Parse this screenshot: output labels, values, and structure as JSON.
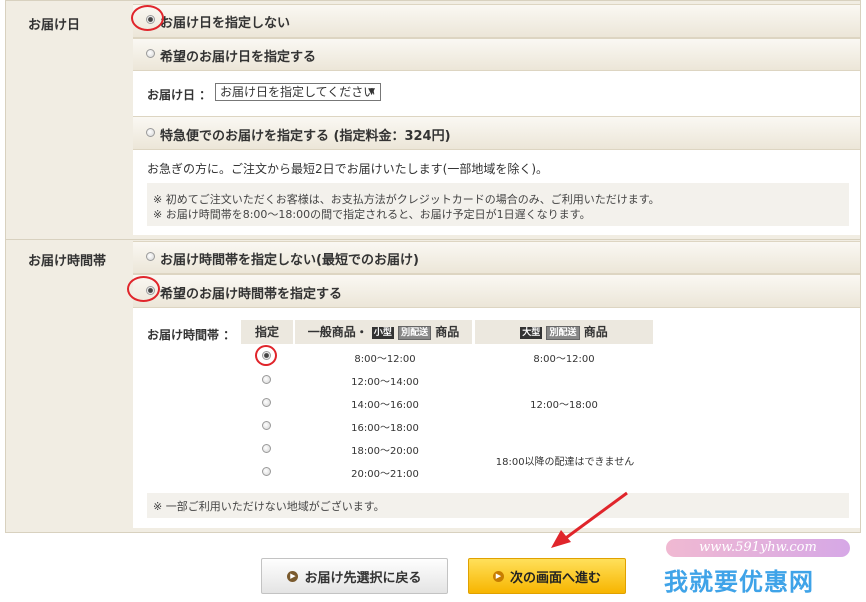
{
  "delivery_date": {
    "label": "お届け日",
    "option_none": "お届け日を指定しない",
    "option_specify": "希望のお届け日を指定する",
    "date_field_label": "お届け日 ：",
    "date_select_value": "お届け日を指定してください",
    "option_express": "特急便でのお届けを指定する (指定料金：324円)",
    "express_desc": "お急ぎの方に。ご注文から最短2日でお届けいたします(一部地域を除く)。",
    "express_notes": [
      "※ 初めてご注文いただくお客様は、お支払方法がクレジットカードの場合のみ、ご利用いただけます。",
      "※ お届け時間帯を8:00～18:00の間で指定されると、お届け予定日が1日遅くなります。"
    ]
  },
  "delivery_time": {
    "label": "お届け時間帯",
    "option_none": "お届け時間帯を指定しない(最短でのお届け)",
    "option_specify": "希望のお届け時間帯を指定する",
    "field_label": "お届け時間帯 ：",
    "col_select": "指定",
    "col_general_prefix": "一般商品・",
    "col_general_badge_size": "小型",
    "col_general_badge_ship": "別配送",
    "col_general_suffix": "商品",
    "col_large_badge_size": "大型",
    "col_large_badge_ship": "別配送",
    "col_large_suffix": "商品",
    "slots": [
      "8:00～12:00",
      "12:00～14:00",
      "14:00～16:00",
      "16:00～18:00",
      "18:00～20:00",
      "20:00～21:00"
    ],
    "large_slots": [
      "8:00～12:00",
      "12:00～18:00",
      "18:00以降の配達はできません"
    ],
    "note": "※ 一部ご利用いただけない地域がございます。"
  },
  "buttons": {
    "back": "お届け先選択に戻る",
    "next": "次の画面へ進む"
  },
  "watermark": {
    "url": "www.591yhw.com",
    "text": "我就要优惠网"
  },
  "colors": {
    "highlight": "#e0252b",
    "next_button": "#f7b500"
  }
}
